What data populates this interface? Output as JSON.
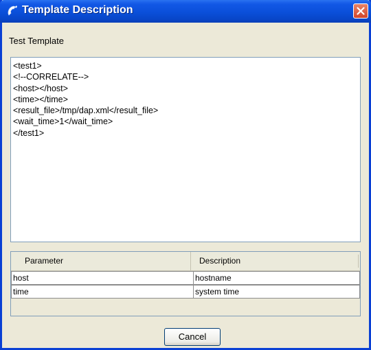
{
  "window": {
    "title": "Template Description",
    "title_icon": "telephone-handset-icon",
    "close_icon": "close-icon",
    "colors": {
      "titlebar": "#0a4fd9",
      "close": "#d2452a",
      "body": "#ece9d8"
    }
  },
  "template": {
    "name": "Test Template",
    "xml": "<test1>\n<!--CORRELATE-->\n<host></host>\n<time></time>\n<result_file>/tmp/dap.xml</result_file>\n<wait_time>1</wait_time>\n</test1>"
  },
  "table": {
    "headers": [
      "Parameter",
      "Description"
    ],
    "rows": [
      {
        "parameter": "host",
        "description": "hostname"
      },
      {
        "parameter": "time",
        "description": "system time"
      }
    ]
  },
  "buttons": {
    "cancel": "Cancel"
  }
}
